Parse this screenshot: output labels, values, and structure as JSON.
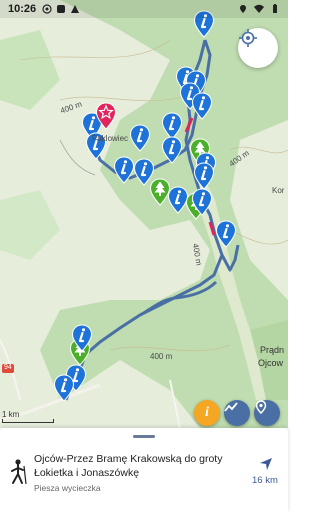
{
  "status_bar": {
    "time": "10:26"
  },
  "map": {
    "labels": {
      "puklowiec": "Puklowiec",
      "pradnik": "Prądn",
      "ojcow": "Ojcow",
      "kor": "Kor",
      "contour_400": "400 m",
      "contour_400b": "400 m",
      "contour_400c": "400 m",
      "contour_400d": "400 m",
      "road_94": "94",
      "scale": "1 km"
    }
  },
  "route": {
    "color": "#4a6fa5"
  },
  "markers": {
    "info_color": "#1e73d8",
    "tree_color": "#4caf2a",
    "star_color": "#e0245e"
  },
  "buttons": {
    "info_label": "i"
  },
  "trail": {
    "title": "Ojców-Przez Bramę Krakowską do groty Łokietka i Jonaszówkę",
    "type": "Piesza wycieczka",
    "distance": "16 km"
  }
}
